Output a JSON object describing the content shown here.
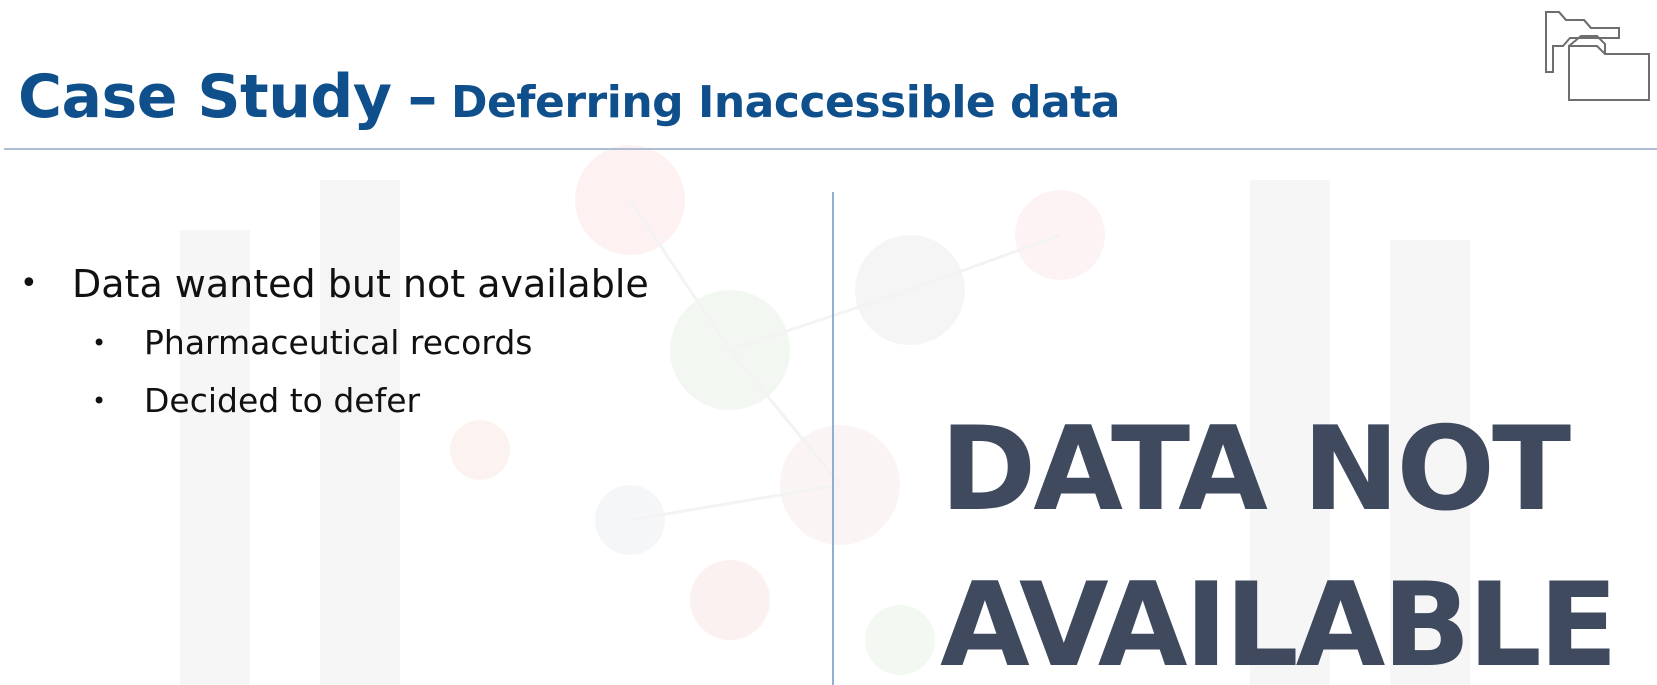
{
  "slide": {
    "title_main": "Case Study",
    "title_dash": "–",
    "title_sub": "Deferring Inaccessible data",
    "bullets": [
      {
        "text": "Data wanted but not available",
        "sub": [
          "Pharmaceutical records",
          "Decided to defer"
        ]
      }
    ],
    "image_text": {
      "line1": "DATA NOT",
      "line2": "AVAILABLE"
    }
  },
  "icons": {
    "corner": "folders-icon"
  },
  "colors": {
    "title": "#0e4f8c",
    "rule": "#aebdd3",
    "divider": "#8fb0d0",
    "image_text": "#3f4a5e"
  }
}
